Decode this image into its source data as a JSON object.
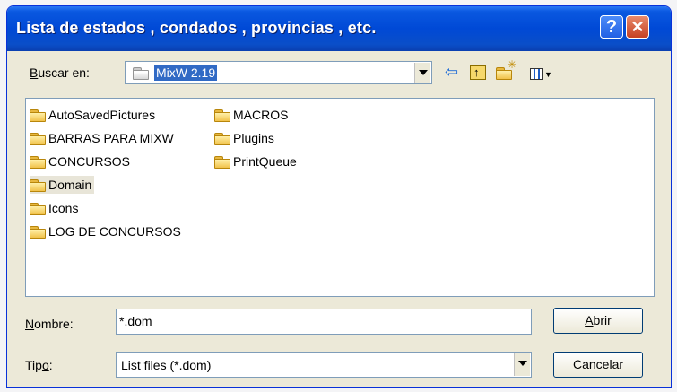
{
  "window": {
    "title": "Lista de estados , condados , provincias , etc."
  },
  "title_buttons": {
    "help": "?",
    "close": "✕"
  },
  "lookin": {
    "label_first": "B",
    "label_rest": "uscar en:",
    "value": "MixW 2.19"
  },
  "toolbar": {
    "back_icon": "back-arrow-icon",
    "up_icon": "up-folder-icon",
    "new_folder_icon": "new-folder-icon",
    "view_icon": "view-menu-icon"
  },
  "files": {
    "column1": [
      "AutoSavedPictures",
      "BARRAS PARA MIXW",
      "CONCURSOS",
      "Domain",
      "Icons",
      "LOG DE CONCURSOS"
    ],
    "column2": [
      "MACROS",
      "Plugins",
      "PrintQueue"
    ],
    "selected": "Domain"
  },
  "filename": {
    "label_first": "N",
    "label_rest": "ombre:",
    "value": "*.dom"
  },
  "filetype": {
    "label_start": "Tip",
    "label_underlined": "o",
    "label_end": ":",
    "value": "List files (*.dom)"
  },
  "buttons": {
    "open_first": "A",
    "open_rest": "brir",
    "cancel": "Cancelar"
  }
}
